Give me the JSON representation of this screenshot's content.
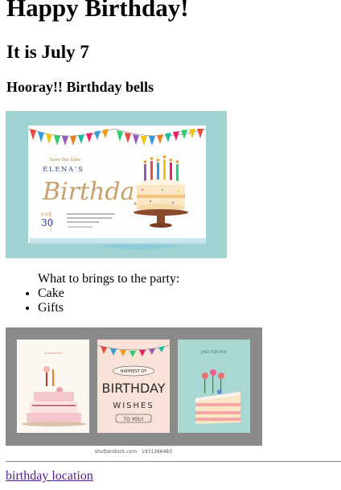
{
  "headings": {
    "title": "Happy Birthday!",
    "date": "It is July 7",
    "subtitle": "Hooray!! Birthday bells"
  },
  "invitation": {
    "small_caption": "Save the Date",
    "name": "ELENA'S",
    "script_word": "Birthday",
    "month": "JULY",
    "day": "30"
  },
  "party": {
    "intro": "What to brings to the party:",
    "items": [
      "Cake",
      "Gifts"
    ]
  },
  "cards": {
    "card2_top": "HAPPIEST OF",
    "card2_main": "BIRTHDAY",
    "card2_sub": "WISHES",
    "card2_bottom": "TO YOU!",
    "card3_caption": "JUST FOR YOU",
    "watermark": "shutterstock.com · 1931366483"
  },
  "footer": {
    "link_text": "birthday location"
  },
  "colors": {
    "link_visited": "#551a8b",
    "invitation_bg": "#9fd3d2",
    "cards_bg": "#8a8a8a"
  }
}
